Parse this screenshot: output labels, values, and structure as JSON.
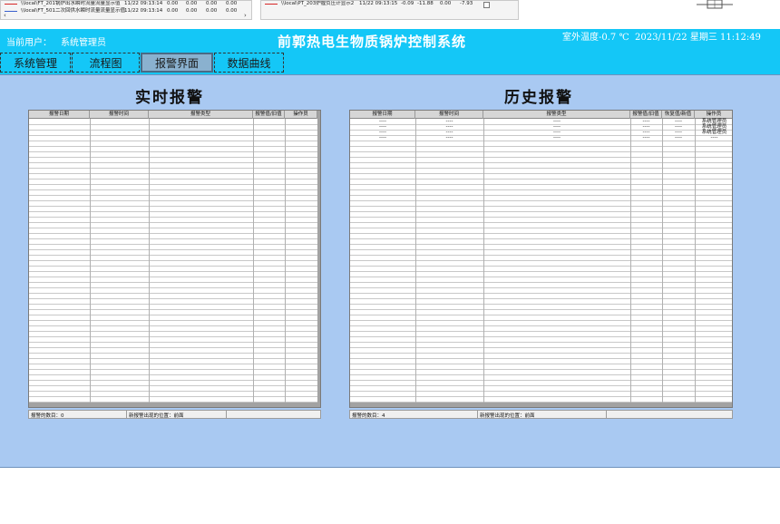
{
  "top_trends": {
    "left_panel": {
      "rows": [
        {
          "tag": "\\\\local\\FT_201锅炉出水瞬时流量流量显示值",
          "time": "11/22 09:13:14",
          "v1": "0.00",
          "v2": "0.00",
          "v3": "0.00",
          "v4": "0.00",
          "color": "#d62828"
        },
        {
          "tag": "\\\\local\\FT_501二次回供水瞬时流量流量显示值",
          "time": "11/22 09:13:14",
          "v1": "0.00",
          "v2": "0.00",
          "v3": "0.00",
          "v4": "0.00",
          "color": "#3a5fcd"
        }
      ],
      "scroll_left": "‹",
      "scroll_right": "›"
    },
    "right_panel": {
      "rows": [
        {
          "tag": "\\\\local\\PT_203炉膛负压计显示2",
          "time": "11/22 09:13:15",
          "v1": "-0.09",
          "v2": "-11.88",
          "v3": "0.00",
          "v4": "-7.93",
          "color": "#d62828"
        }
      ]
    }
  },
  "header": {
    "current_user_label": "当前用户：",
    "current_user_value": "系统管理员",
    "title": "前郭热电生物质锅炉控制系统",
    "outdoor_temp": "室外温度-0.7 ℃",
    "datetime": "2023/11/22 星期三 11:12:49",
    "bg_color": "#14c7f7"
  },
  "tabs": [
    {
      "label": "系统管理",
      "active": false
    },
    {
      "label": "流程图",
      "active": false
    },
    {
      "label": "报警界面",
      "active": true
    },
    {
      "label": "数据曲线",
      "active": false
    }
  ],
  "realtime": {
    "title": "实时报警",
    "columns": [
      "报警日期",
      "报警时间",
      "报警类型",
      "报警值/旧值",
      "操作员"
    ],
    "rows": [],
    "status": {
      "count": "报警的数目：0",
      "position": "新报警出现的位置：前面"
    }
  },
  "history": {
    "title": "历史报警",
    "columns": [
      "报警日期",
      "报警时间",
      "报警类型",
      "报警值/旧值",
      "恢复值/新值",
      "操作员"
    ],
    "rows": [
      {
        "date": "----",
        "time": "----",
        "type": "----",
        "value": "----",
        "restore": "----",
        "operator": "系统管理员"
      },
      {
        "date": "----",
        "time": "----",
        "type": "----",
        "value": "----",
        "restore": "----",
        "operator": "系统管理员"
      },
      {
        "date": "----",
        "time": "----",
        "type": "----",
        "value": "----",
        "restore": "----",
        "operator": "系统管理员"
      },
      {
        "date": "----",
        "time": "----",
        "type": "----",
        "value": "----",
        "restore": "----",
        "operator": "----"
      }
    ],
    "status": {
      "count": "报警的数目：4",
      "position": "新报警出现的位置：前面"
    }
  },
  "colors": {
    "content_bg": "#a9c9f2",
    "tab_active": "#8ab1cf"
  }
}
